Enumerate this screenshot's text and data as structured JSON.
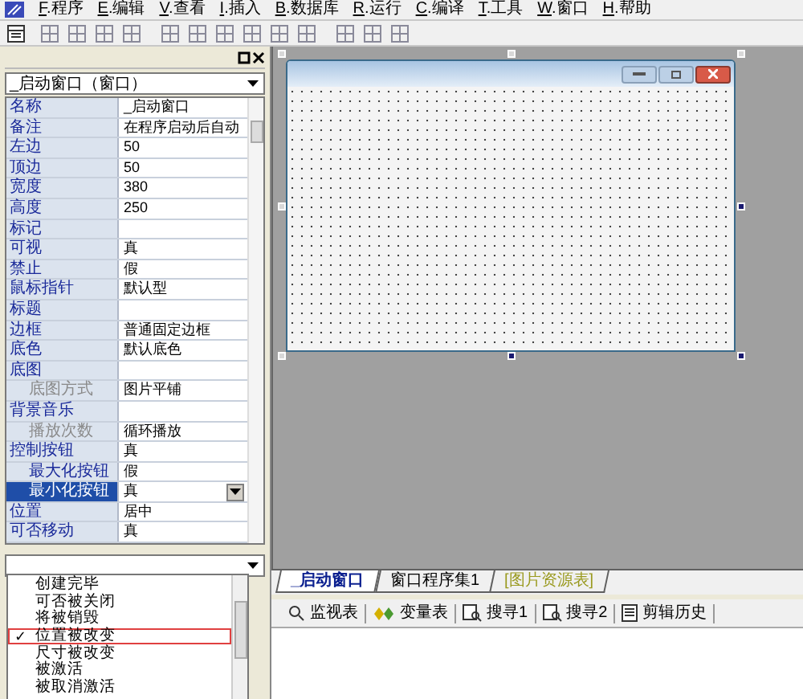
{
  "menu": [
    {
      "key": "F",
      "label": ".程序"
    },
    {
      "key": "E",
      "label": ".编辑"
    },
    {
      "key": "V",
      "label": ".查看"
    },
    {
      "key": "I",
      "label": ".插入"
    },
    {
      "key": "B",
      "label": ".数据库"
    },
    {
      "key": "R",
      "label": ".运行"
    },
    {
      "key": "C",
      "label": ".编译"
    },
    {
      "key": "T",
      "label": ".工具"
    },
    {
      "key": "W",
      "label": ".窗口"
    },
    {
      "key": "H",
      "label": ".帮助"
    }
  ],
  "object_selector": {
    "value": "_启动窗口（窗口）"
  },
  "properties": [
    {
      "name": "名称",
      "value": "_启动窗口",
      "selected": false
    },
    {
      "name": "备注",
      "value": "在程序启动后自动",
      "selected": false
    },
    {
      "name": "左边",
      "value": "50",
      "selected": false
    },
    {
      "name": "顶边",
      "value": "50",
      "selected": false
    },
    {
      "name": "宽度",
      "value": "380",
      "selected": false
    },
    {
      "name": "高度",
      "value": "250",
      "selected": false
    },
    {
      "name": "标记",
      "selected": false
    },
    {
      "name": "可视",
      "value": "真",
      "selected": false
    },
    {
      "name": "禁止",
      "value": "假",
      "selected": false
    },
    {
      "name": "鼠标指针",
      "value": "默认型",
      "selected": false
    },
    {
      "name": "标题",
      "selected": false
    },
    {
      "name": "边框",
      "value": "普通固定边框",
      "selected": false
    },
    {
      "name": "底色",
      "value": "默认底色",
      "selected": false
    },
    {
      "name": "底图",
      "selected": false,
      "children": [
        {
          "name": "底图方式",
          "value": "图片平铺",
          "disabled": true,
          "selected": false
        }
      ]
    },
    {
      "name": "背景音乐",
      "selected": false,
      "children": [
        {
          "name": "播放次数",
          "value": "循环播放",
          "disabled": true,
          "selected": false
        }
      ]
    },
    {
      "name": "控制按钮",
      "value": "真",
      "selected": false,
      "children": [
        {
          "name": "最大化按钮",
          "value": "假",
          "disabled": false,
          "selected": false
        },
        {
          "name": "最小化按钮",
          "value": "真",
          "disabled": false,
          "selected": true
        }
      ]
    },
    {
      "name": "位置",
      "value": "居中",
      "selected": false
    },
    {
      "name": "可否移动",
      "value": "真",
      "selected": false
    }
  ],
  "events": [
    {
      "label": "创建完毕",
      "checked": false,
      "selected": false
    },
    {
      "label": "可否被关闭",
      "checked": false,
      "selected": false
    },
    {
      "label": "将被销毁",
      "checked": false,
      "selected": false
    },
    {
      "label": "位置被改变",
      "checked": true,
      "selected": true
    },
    {
      "label": "尺寸被改变",
      "checked": false,
      "selected": false
    },
    {
      "label": "被激活",
      "checked": false,
      "selected": false
    },
    {
      "label": "被取消激活",
      "checked": false,
      "selected": false
    }
  ],
  "check_mark": "✓",
  "doc_tabs": [
    {
      "label": "_启动窗口",
      "selected": true,
      "kind": "window"
    },
    {
      "label": "窗口程序集1",
      "selected": false,
      "kind": "module"
    },
    {
      "label": "[图片资源表]",
      "selected": false,
      "kind": "resource"
    }
  ],
  "bottom_tools": [
    {
      "label": "监视表",
      "kind": "watch"
    },
    {
      "label": "变量表",
      "kind": "vars"
    },
    {
      "label": "搜寻1",
      "kind": "find"
    },
    {
      "label": "搜寻2",
      "kind": "find"
    },
    {
      "label": "剪辑历史",
      "kind": "history"
    }
  ]
}
